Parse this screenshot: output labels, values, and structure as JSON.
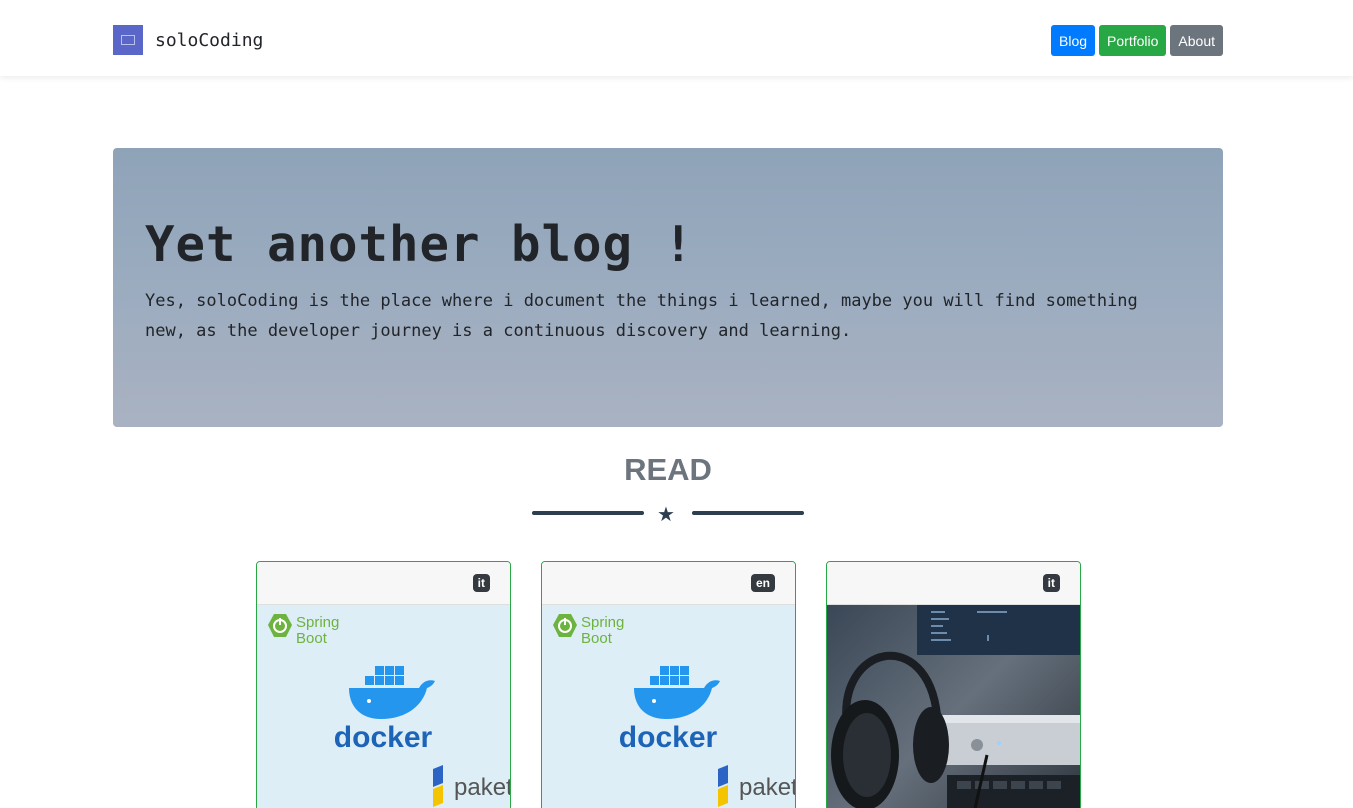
{
  "navbar": {
    "brand": "soloCoding",
    "buttons": {
      "blog": "Blog",
      "portfolio": "Portfolio",
      "about": "About"
    }
  },
  "hero": {
    "title": "Yet another blog !",
    "text": "Yes, soloCoding is the place where i document the things i learned, maybe you will find something new, as the developer journey is a continuous discovery and learning."
  },
  "section": {
    "title": "READ"
  },
  "cards": [
    {
      "lang": "it",
      "image": {
        "spring": "Spring",
        "boot": "Boot",
        "docker": "docker",
        "paketo": "paketo"
      }
    },
    {
      "lang": "en",
      "image": {
        "spring": "Spring",
        "boot": "Boot",
        "docker": "docker",
        "paketo": "paketo"
      }
    },
    {
      "lang": "it"
    }
  ],
  "colors": {
    "primary": "#007bff",
    "success": "#28a745",
    "secondary": "#6c757d",
    "dark": "#343a40",
    "heading": "#2c3e50",
    "spring": "#6db33f",
    "docker": "#2496ed"
  }
}
